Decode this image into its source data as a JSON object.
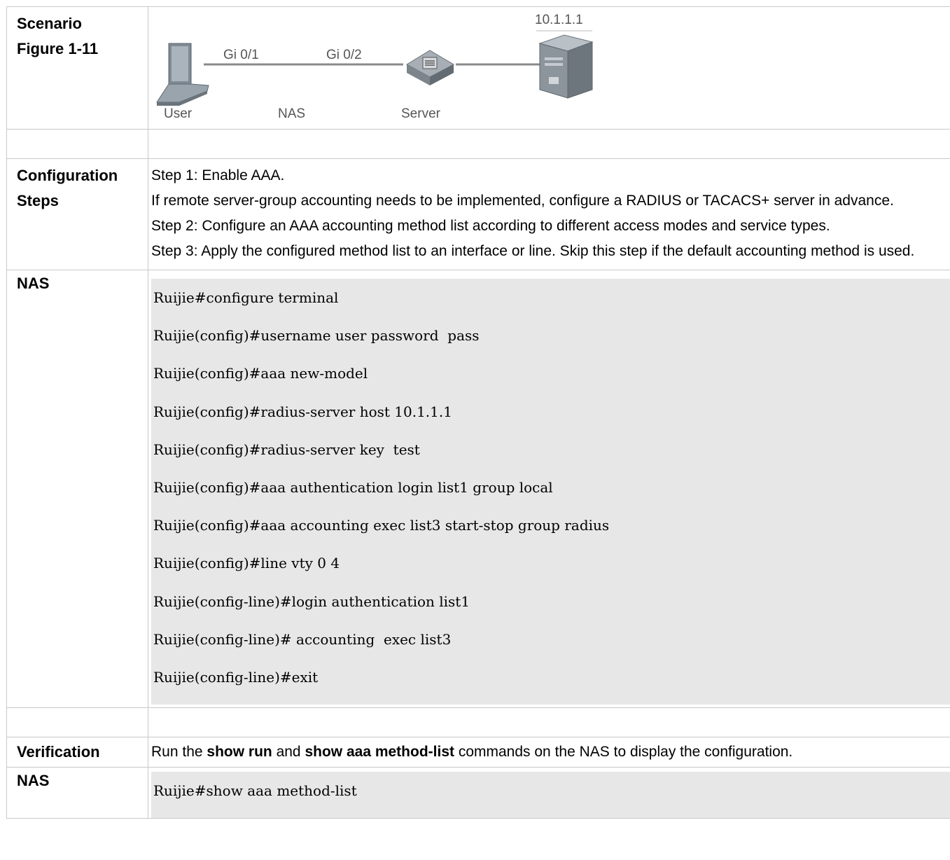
{
  "scenario": {
    "label1": "Scenario",
    "label2": "Figure 1-11"
  },
  "topology": {
    "ip": "10.1.1.1",
    "port1": "Gi 0/1",
    "port2": "Gi 0/2",
    "user": "User",
    "nas": "NAS",
    "server": "Server"
  },
  "config_steps": {
    "label1": "Configuration",
    "label2": "Steps",
    "step1": "Step 1: Enable AAA.",
    "step1_note": "If remote server-group accounting needs to be implemented, configure a RADIUS or TACACS+ server in advance.",
    "step2": "Step 2: Configure an AAA accounting method list according to different access modes and service types.",
    "step3": "Step 3: Apply the configured method list to an interface or line. Skip this step if the default accounting method is used."
  },
  "nas_config": {
    "label": "NAS",
    "lines": [
      "Ruijie#configure terminal",
      "Ruijie(config)#username user password  pass",
      "Ruijie(config)#aaa new-model",
      "Ruijie(config)#radius-server host 10.1.1.1",
      "Ruijie(config)#radius-server key  test",
      "Ruijie(config)#aaa authentication login list1 group local",
      "Ruijie(config)#aaa accounting exec list3 start-stop group radius",
      "Ruijie(config)#line vty 0 4",
      "Ruijie(config-line)#login authentication list1",
      "Ruijie(config-line)# accounting  exec list3",
      "Ruijie(config-line)#exit"
    ]
  },
  "verification": {
    "label": "Verification",
    "text_pre": "Run the ",
    "cmd1": "show run",
    "text_mid": " and ",
    "cmd2": "show aaa method-list",
    "text_post": " commands on the NAS to display the configuration."
  },
  "nas_verify": {
    "label": "NAS",
    "lines": [
      "Ruijie#show aaa method-list"
    ]
  },
  "colors": {
    "border": "#c8c8c8",
    "cli_bg": "#e7e7e7"
  }
}
